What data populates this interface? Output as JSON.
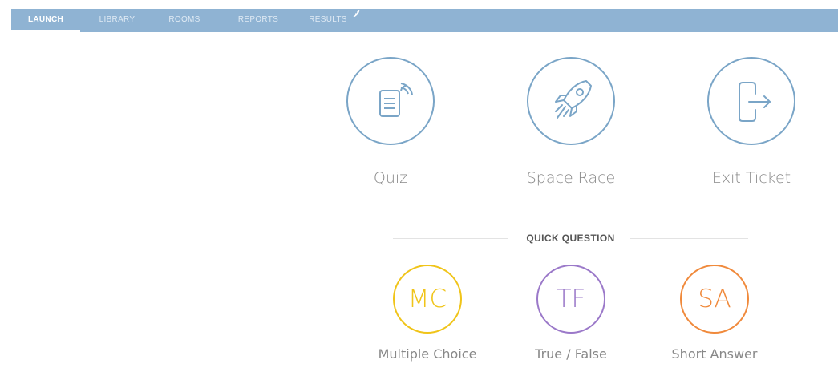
{
  "nav": {
    "tabs": [
      {
        "label": "LAUNCH",
        "active": true
      },
      {
        "label": "LIBRARY",
        "active": false
      },
      {
        "label": "ROOMS",
        "active": false
      },
      {
        "label": "REPORTS",
        "active": false
      },
      {
        "label": "RESULTS",
        "active": false
      }
    ]
  },
  "launch": {
    "items": [
      {
        "label": "Quiz",
        "icon": "quiz-icon"
      },
      {
        "label": "Space Race",
        "icon": "rocket-icon"
      },
      {
        "label": "Exit Ticket",
        "icon": "exit-icon"
      }
    ]
  },
  "quick_question": {
    "title": "QUICK QUESTION",
    "items": [
      {
        "abbr": "MC",
        "label": "Multiple Choice",
        "color": "#f0c419"
      },
      {
        "abbr": "TF",
        "label": "True / False",
        "color": "#9b79c9"
      },
      {
        "abbr": "SA",
        "label": "Short Answer",
        "color": "#f08a3c"
      }
    ]
  },
  "colors": {
    "nav_background": "#8fb3d3",
    "icon_stroke": "#7aa5c7"
  }
}
